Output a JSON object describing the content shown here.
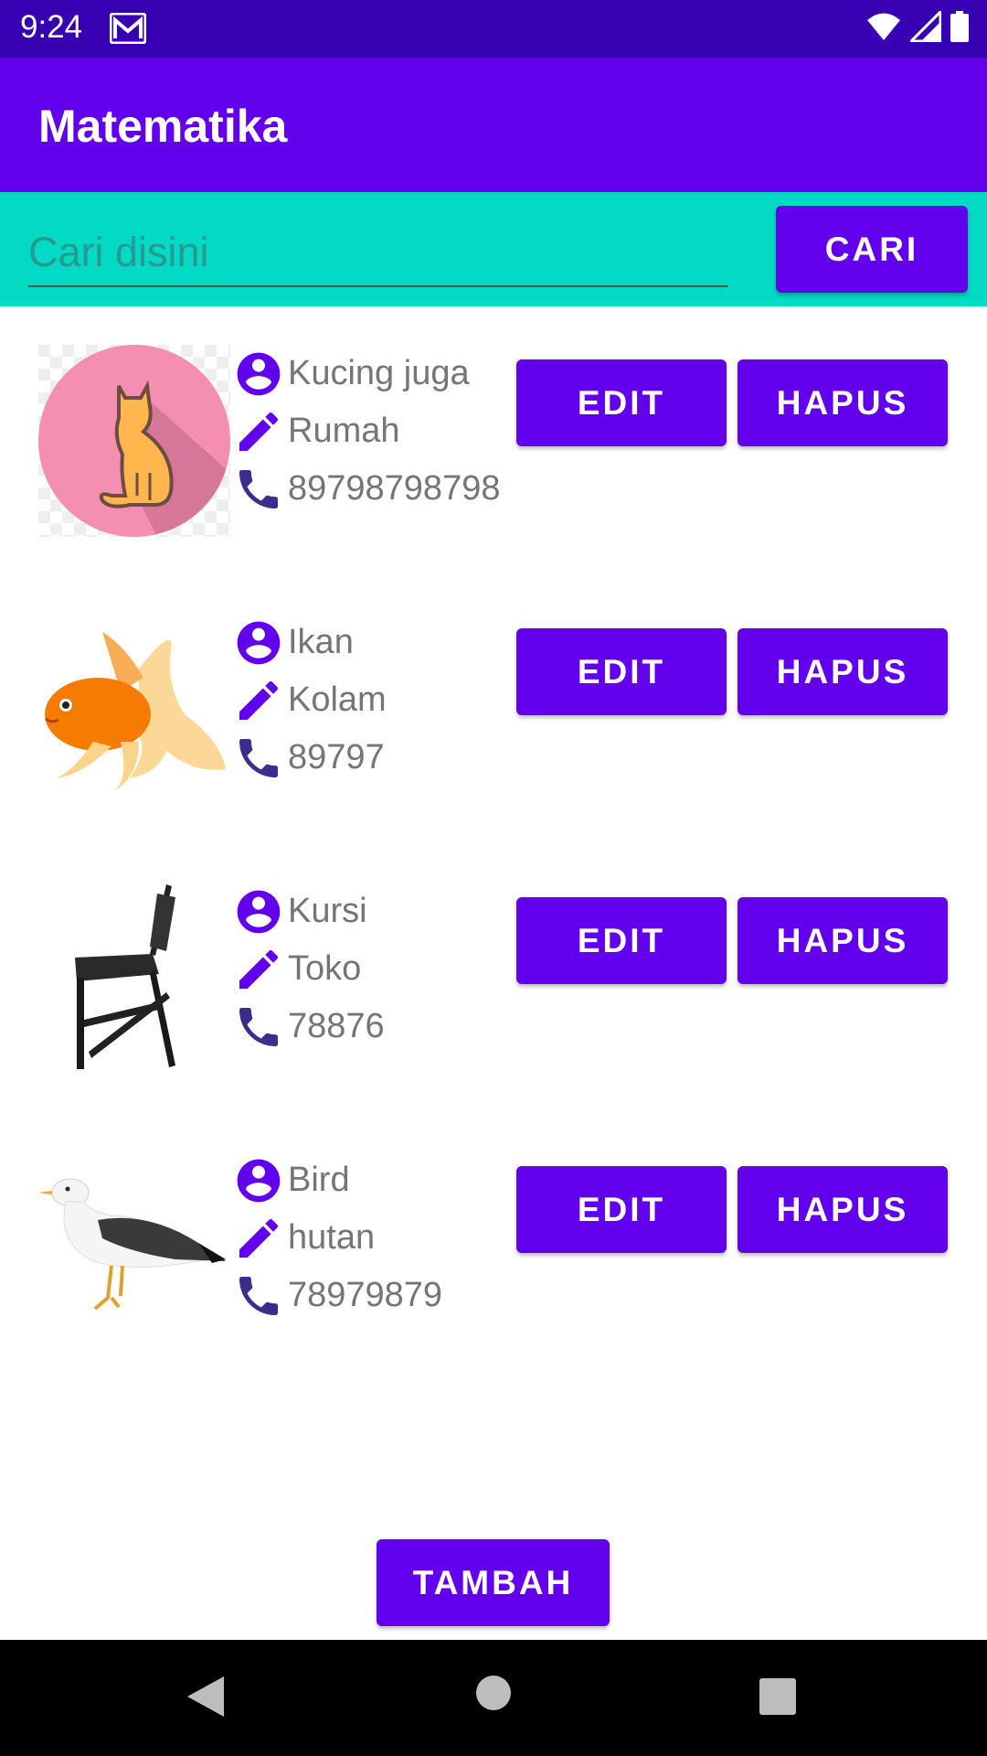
{
  "status_bar": {
    "time": "9:24"
  },
  "app_bar": {
    "title": "Matematika"
  },
  "search": {
    "placeholder": "Cari disini",
    "value": "",
    "button_label": "CARI"
  },
  "items": [
    {
      "name": "Kucing juga",
      "place": "Rumah",
      "phone": "89798798798",
      "image": "cat-icon",
      "edit_label": "EDIT",
      "delete_label": "HAPUS"
    },
    {
      "name": "Ikan",
      "place": "Kolam",
      "phone": "89797",
      "image": "goldfish-photo",
      "edit_label": "EDIT",
      "delete_label": "HAPUS"
    },
    {
      "name": "Kursi",
      "place": "Toko",
      "phone": "78876",
      "image": "chair-photo",
      "edit_label": "EDIT",
      "delete_label": "HAPUS"
    },
    {
      "name": "Bird",
      "place": "hutan",
      "phone": "78979879",
      "image": "gull-photo",
      "edit_label": "EDIT",
      "delete_label": "HAPUS"
    }
  ],
  "footer": {
    "add_label": "TAMBAH"
  },
  "colors": {
    "primary": "#6200ee",
    "primary_dark": "#3700b3",
    "accent": "#03dac5",
    "text_secondary": "#757575",
    "icon": "#6200ee"
  }
}
